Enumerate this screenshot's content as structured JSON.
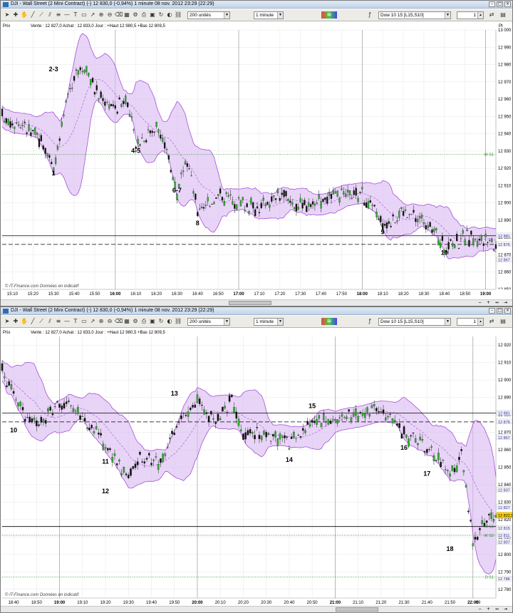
{
  "windows": [
    {
      "title": "DJI - Wall Street (2 Mini Contract) (-)   12 830,0 (-0,94%)   1 minute   08 nov. 2012 23:29 (22:29)",
      "units_select": "200 unités",
      "interval_select": "1 minute",
      "indicator_select": "Dow 10 15 [L15,S10]",
      "count_value": "1",
      "info_prefix": "Prix",
      "info_line": "Vente : 12 827,0 Achat : 12 833,0 Jour : +Haut 12 980,5 +Bas 12 809,5",
      "watermark": "© IT-Finance.com  Données en indicatif",
      "time_labels": [
        "15:10",
        "15:20",
        "15:30",
        "15:40",
        "15:50",
        "16:00",
        "16:10",
        "16:20",
        "16:30",
        "16:40",
        "16:50",
        "17:00",
        "17:10",
        "17:20",
        "17:30",
        "17:40",
        "17:50",
        "18:00",
        "18:10",
        "18:20",
        "18:30",
        "18:40",
        "18:50",
        "19:00"
      ],
      "bold_times": [
        "16:00",
        "17:00",
        "18:00",
        "19:00"
      ],
      "price_unit": "Pt",
      "price_labels": [
        "13 000",
        "12 990",
        "12 980",
        "12 970",
        "12 960",
        "12 950",
        "12 940",
        "12 930",
        "12 920",
        "12 910",
        "12 900",
        "12 890",
        "12 880",
        "12 870",
        "12 860",
        "12 850"
      ],
      "markers": [
        {
          "text": "1",
          "price": 12916,
          "time": "15:30"
        },
        {
          "text": "2-3",
          "price": 12976,
          "time": "15:30"
        },
        {
          "text": "4-5",
          "price": 12929,
          "time": "16:10"
        },
        {
          "text": "6-7",
          "price": 12906,
          "time": "16:30"
        },
        {
          "text": "8",
          "price": 12887,
          "time": "16:40"
        },
        {
          "text": "9",
          "price": 12882,
          "time": "18:10"
        },
        {
          "text": "10",
          "price": 12870,
          "time": "18:40"
        }
      ],
      "level_tags": [
        {
          "text": "W S1",
          "price": 12928
        },
        {
          "text": "12 881",
          "price": 12881
        },
        {
          "text": "12 876",
          "price": 12876
        },
        {
          "text": "12 867",
          "price": 12867
        }
      ]
    },
    {
      "title": "DJI - Wall Street (2 Mini Contract) (-)   12 830,0 (-0,94%)   1 minute   08 nov. 2012 23:29 (22:29)",
      "units_select": "200 unités",
      "interval_select": "1 minute",
      "indicator_select": "Dow 10 15 [L15,S10]",
      "count_value": "1",
      "info_prefix": "Prix",
      "info_line": "Vente : 12 827,0 Achat : 12 833,0 Jour : +Haut 12 980,5 +Bas 12 809,5",
      "watermark": "© IT-Finance.com  Données en indicatif",
      "time_labels": [
        "18:40",
        "18:50",
        "19:00",
        "19:10",
        "19:20",
        "19:30",
        "19:40",
        "19:50",
        "20:00",
        "20:10",
        "20:20",
        "20:30",
        "20:40",
        "20:50",
        "21:00",
        "21:10",
        "21:20",
        "21:30",
        "21:40",
        "21:50",
        "22:00"
      ],
      "bold_times": [
        "19:00",
        "20:00",
        "21:00",
        "22:00"
      ],
      "extra_time": "09",
      "price_labels": [
        "12 920",
        "12 910",
        "12 900",
        "12 890",
        "12 880",
        "12 870",
        "12 860",
        "12 850",
        "12 840",
        "12 830",
        "12 820",
        "12 810",
        "12 800",
        "12 790",
        "12 780"
      ],
      "markers": [
        {
          "text": "10",
          "price": 12870,
          "time": "18:40"
        },
        {
          "text": "11",
          "price": 12852,
          "time": "19:20"
        },
        {
          "text": "12",
          "price": 12835,
          "time": "19:20"
        },
        {
          "text": "13",
          "price": 12891,
          "time": "19:50"
        },
        {
          "text": "14",
          "price": 12853,
          "time": "20:40"
        },
        {
          "text": "15",
          "price": 12884,
          "time": "20:50"
        },
        {
          "text": "16",
          "price": 12860,
          "time": "21:30"
        },
        {
          "text": "17",
          "price": 12845,
          "time": "21:40"
        },
        {
          "text": "18",
          "price": 12802,
          "time": "21:50"
        }
      ],
      "level_tags": [
        {
          "text": "12 881",
          "price": 12881
        },
        {
          "text": "12 876",
          "price": 12876
        },
        {
          "text": "12 867",
          "price": 12867
        },
        {
          "text": "12 837",
          "price": 12837
        },
        {
          "text": "12 827",
          "price": 12827
        },
        {
          "text": "12 822,5",
          "price": 12822.5,
          "current": true
        },
        {
          "text": "M S1",
          "price": 12816
        },
        {
          "text": "12 815",
          "price": 12815
        },
        {
          "text": "W S2",
          "price": 12811
        },
        {
          "text": "12 811",
          "price": 12811
        },
        {
          "text": "12 807",
          "price": 12807
        },
        {
          "text": "D S1",
          "price": 12787
        },
        {
          "text": "12 786",
          "price": 12786
        }
      ]
    }
  ],
  "chart_data": [
    {
      "type": "candlestick",
      "x_range": [
        "15:05",
        "19:05"
      ],
      "ylim": [
        12850,
        13000
      ],
      "lines": [
        {
          "name": "W S1",
          "value": 12928,
          "style": "dotted",
          "color": "#2e8b2e"
        },
        {
          "name": "resistance",
          "value": 12881,
          "style": "solid",
          "color": "#000000"
        },
        {
          "name": "resistance2",
          "value": 12876,
          "style": "dashed",
          "color": "#000000"
        }
      ],
      "close_path": [
        {
          "x": "15:05",
          "y": 12950
        },
        {
          "x": "15:15",
          "y": 12945
        },
        {
          "x": "15:25",
          "y": 12935
        },
        {
          "x": "15:30",
          "y": 12920
        },
        {
          "x": "15:35",
          "y": 12950
        },
        {
          "x": "15:40",
          "y": 12975
        },
        {
          "x": "15:45",
          "y": 12980
        },
        {
          "x": "15:50",
          "y": 12965
        },
        {
          "x": "16:00",
          "y": 12955
        },
        {
          "x": "16:05",
          "y": 12960
        },
        {
          "x": "16:10",
          "y": 12935
        },
        {
          "x": "16:20",
          "y": 12945
        },
        {
          "x": "16:25",
          "y": 12930
        },
        {
          "x": "16:30",
          "y": 12905
        },
        {
          "x": "16:35",
          "y": 12925
        },
        {
          "x": "16:40",
          "y": 12895
        },
        {
          "x": "16:50",
          "y": 12905
        },
        {
          "x": "17:00",
          "y": 12900
        },
        {
          "x": "17:10",
          "y": 12897
        },
        {
          "x": "17:20",
          "y": 12905
        },
        {
          "x": "17:30",
          "y": 12898
        },
        {
          "x": "17:40",
          "y": 12902
        },
        {
          "x": "17:50",
          "y": 12903
        },
        {
          "x": "18:00",
          "y": 12905
        },
        {
          "x": "18:05",
          "y": 12897
        },
        {
          "x": "18:10",
          "y": 12888
        },
        {
          "x": "18:20",
          "y": 12895
        },
        {
          "x": "18:30",
          "y": 12890
        },
        {
          "x": "18:40",
          "y": 12875
        },
        {
          "x": "18:50",
          "y": 12880
        },
        {
          "x": "19:00",
          "y": 12878
        },
        {
          "x": "19:05",
          "y": 12876
        }
      ]
    },
    {
      "type": "candlestick",
      "x_range": [
        "18:35",
        "22:10"
      ],
      "ylim": [
        12775,
        12925
      ],
      "lines": [
        {
          "name": "resistance",
          "value": 12881,
          "style": "solid",
          "color": "#000000"
        },
        {
          "name": "resistance2",
          "value": 12876,
          "style": "dashed",
          "color": "#000000"
        },
        {
          "name": "M S1",
          "value": 12816,
          "style": "solid",
          "color": "#000000"
        },
        {
          "name": "W S2",
          "value": 12811,
          "style": "dotted",
          "color": "#2e8b2e"
        },
        {
          "name": "D S1",
          "value": 12787,
          "style": "dotted",
          "color": "#2e8b2e"
        }
      ],
      "close_path": [
        {
          "x": "18:35",
          "y": 12905
        },
        {
          "x": "18:45",
          "y": 12880
        },
        {
          "x": "18:50",
          "y": 12873
        },
        {
          "x": "19:00",
          "y": 12888
        },
        {
          "x": "19:10",
          "y": 12878
        },
        {
          "x": "19:20",
          "y": 12862
        },
        {
          "x": "19:30",
          "y": 12845
        },
        {
          "x": "19:35",
          "y": 12855
        },
        {
          "x": "19:45",
          "y": 12853
        },
        {
          "x": "19:50",
          "y": 12870
        },
        {
          "x": "20:00",
          "y": 12890
        },
        {
          "x": "20:05",
          "y": 12877
        },
        {
          "x": "20:10",
          "y": 12880
        },
        {
          "x": "20:15",
          "y": 12890
        },
        {
          "x": "20:20",
          "y": 12870
        },
        {
          "x": "20:30",
          "y": 12868
        },
        {
          "x": "20:40",
          "y": 12865
        },
        {
          "x": "20:50",
          "y": 12875
        },
        {
          "x": "21:00",
          "y": 12878
        },
        {
          "x": "21:10",
          "y": 12880
        },
        {
          "x": "21:20",
          "y": 12883
        },
        {
          "x": "21:30",
          "y": 12868
        },
        {
          "x": "21:40",
          "y": 12862
        },
        {
          "x": "21:45",
          "y": 12855
        },
        {
          "x": "21:50",
          "y": 12845
        },
        {
          "x": "21:55",
          "y": 12858
        },
        {
          "x": "22:00",
          "y": 12805
        },
        {
          "x": "22:03",
          "y": 12815
        },
        {
          "x": "22:07",
          "y": 12822
        }
      ]
    }
  ]
}
